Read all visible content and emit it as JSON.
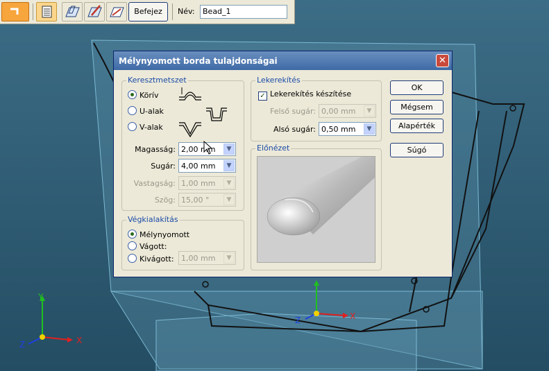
{
  "toolbar": {
    "finish_label": "Befejez",
    "name_label": "Név:",
    "name_value": "Bead_1"
  },
  "dialog": {
    "title": "Mélynyomott borda tulajdonságai",
    "close_symbol": "✕",
    "cross_section": {
      "group_label": "Keresztmetszet",
      "options": [
        {
          "label": "Körív",
          "selected": true
        },
        {
          "label": "U-alak",
          "selected": false
        },
        {
          "label": "V-alak",
          "selected": false
        }
      ],
      "fields": [
        {
          "label": "Magasság:",
          "value": "2,00 mm",
          "enabled": true
        },
        {
          "label": "Sugár:",
          "value": "4,00 mm",
          "enabled": true
        },
        {
          "label": "Vastagság:",
          "value": "1,00 mm",
          "enabled": false
        },
        {
          "label": "Szög:",
          "value": "15,00 °",
          "enabled": false
        }
      ]
    },
    "end_condition": {
      "group_label": "Végkialakítás",
      "options": [
        {
          "label": "Mélynyomott",
          "selected": true
        },
        {
          "label": "Vágott:",
          "selected": false
        },
        {
          "label": "Kivágott:",
          "selected": false
        }
      ],
      "cut_value": "1,00 mm"
    },
    "rounding": {
      "group_label": "Lekerekítés",
      "checkbox_label": "Lekerekítés készítése",
      "checked": true,
      "upper_label": "Felső sugár:",
      "upper_value": "0,00 mm",
      "lower_label": "Alsó sugár:",
      "lower_value": "0,50 mm"
    },
    "preview": {
      "group_label": "Előnézet"
    },
    "buttons": {
      "ok": "OK",
      "cancel": "Mégsem",
      "defaults": "Alapérték",
      "help": "Súgó"
    }
  },
  "axes": {
    "left": {
      "x": "X",
      "y": "Y",
      "z": "Z"
    },
    "center": {
      "x": "X",
      "z": "Z"
    }
  },
  "colors": {
    "viewport_bg": "#2b5a73",
    "dialog_bg": "#ece9d8",
    "title_gradient_top": "#6a8fbf",
    "title_gradient_bottom": "#3e6aa6",
    "group_label": "#1a4ba8",
    "axis_x": "#e02020",
    "axis_y": "#20c020",
    "axis_z": "#2040e0"
  }
}
